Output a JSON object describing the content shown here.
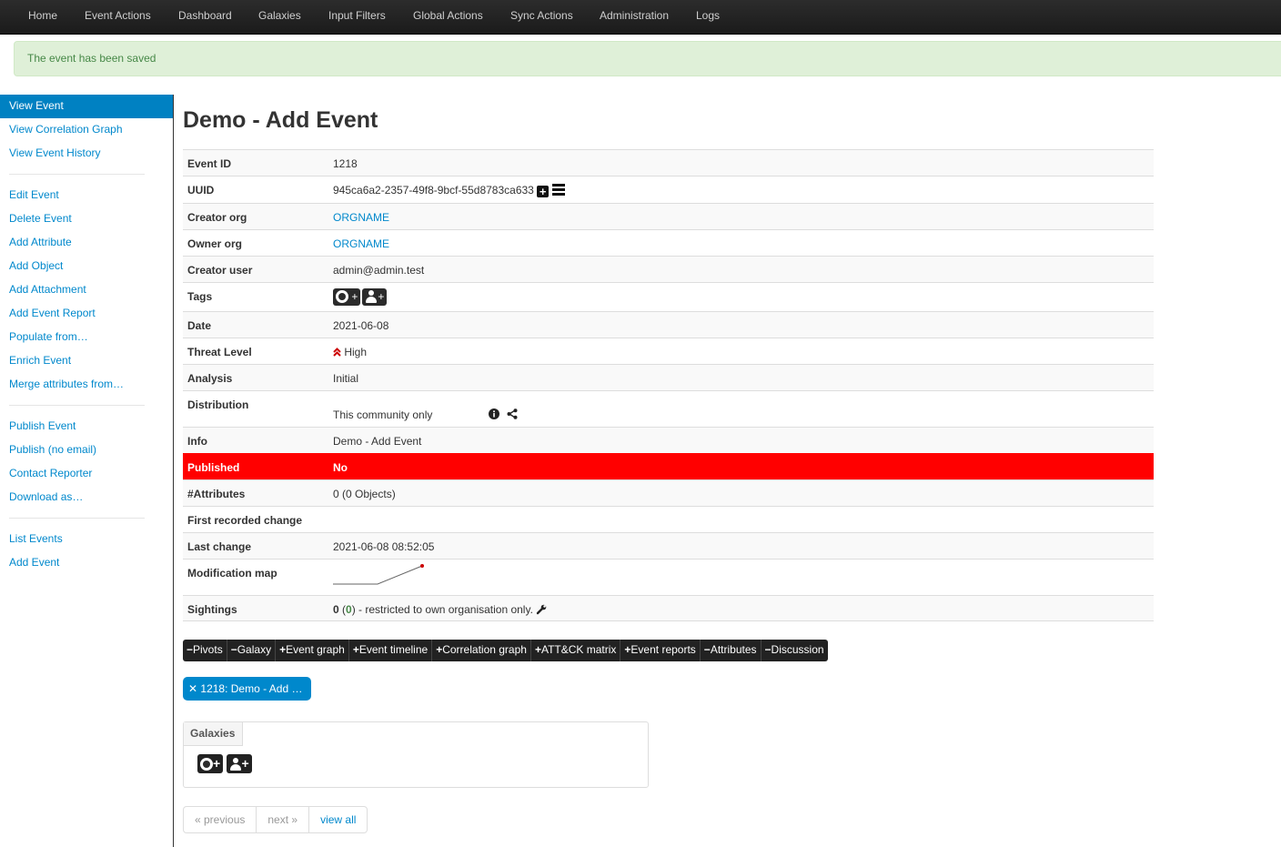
{
  "nav": [
    "Home",
    "Event Actions",
    "Dashboard",
    "Galaxies",
    "Input Filters",
    "Global Actions",
    "Sync Actions",
    "Administration",
    "Logs"
  ],
  "flash": "The event has been saved",
  "sidebar": {
    "group1": [
      "View Event",
      "View Correlation Graph",
      "View Event History"
    ],
    "group2": [
      "Edit Event",
      "Delete Event",
      "Add Attribute",
      "Add Object",
      "Add Attachment",
      "Add Event Report",
      "Populate from…",
      "Enrich Event",
      "Merge attributes from…"
    ],
    "group3": [
      "Publish Event",
      "Publish (no email)",
      "Contact Reporter",
      "Download as…"
    ],
    "group4": [
      "List Events",
      "Add Event"
    ]
  },
  "title": "Demo - Add Event",
  "meta": {
    "event_id": {
      "label": "Event ID",
      "value": "1218"
    },
    "uuid": {
      "label": "UUID",
      "value": "945ca6a2-2357-49f8-9bcf-55d8783ca633"
    },
    "creator_org": {
      "label": "Creator org",
      "value": "ORGNAME"
    },
    "owner_org": {
      "label": "Owner org",
      "value": "ORGNAME"
    },
    "creator_user": {
      "label": "Creator user",
      "value": "admin@admin.test"
    },
    "tags": {
      "label": "Tags",
      "plus": "+"
    },
    "date": {
      "label": "Date",
      "value": "2021-06-08"
    },
    "threat_level": {
      "label": "Threat Level",
      "value": "High"
    },
    "analysis": {
      "label": "Analysis",
      "value": "Initial"
    },
    "distribution": {
      "label": "Distribution",
      "value": "This community only"
    },
    "info": {
      "label": "Info",
      "value": "Demo - Add Event"
    },
    "published": {
      "label": "Published",
      "value": "No"
    },
    "attributes": {
      "label": "#Attributes",
      "value": "0 (0 Objects)"
    },
    "first_change": {
      "label": "First recorded change",
      "value": ""
    },
    "last_change": {
      "label": "Last change",
      "value": "2021-06-08 08:52:05"
    },
    "modification_map": {
      "label": "Modification map"
    },
    "sightings": {
      "label": "Sightings",
      "count": "0",
      "paren_open": " (",
      "positive": "0",
      "rest": ") - restricted to own organisation only."
    }
  },
  "tabs": [
    {
      "sign": "−",
      "label": "Pivots"
    },
    {
      "sign": "−",
      "label": "Galaxy"
    },
    {
      "sign": "+",
      "label": "Event graph"
    },
    {
      "sign": "+",
      "label": "Event timeline"
    },
    {
      "sign": "+",
      "label": "Correlation graph"
    },
    {
      "sign": "+",
      "label": "ATT&CK matrix"
    },
    {
      "sign": "+",
      "label": "Event reports"
    },
    {
      "sign": "−",
      "label": "Attributes"
    },
    {
      "sign": "−",
      "label": "Discussion"
    }
  ],
  "pivot": {
    "close": "✕",
    "label": "1218: Demo - Add …"
  },
  "galaxies": {
    "title": "Galaxies",
    "plus": "+"
  },
  "pager": [
    "« previous",
    "next »",
    "view all"
  ],
  "colors": {
    "accent": "#0088cc",
    "published_no": "#ff0000",
    "success_bg": "#dff0d8",
    "threat_high": "#cc0000"
  }
}
